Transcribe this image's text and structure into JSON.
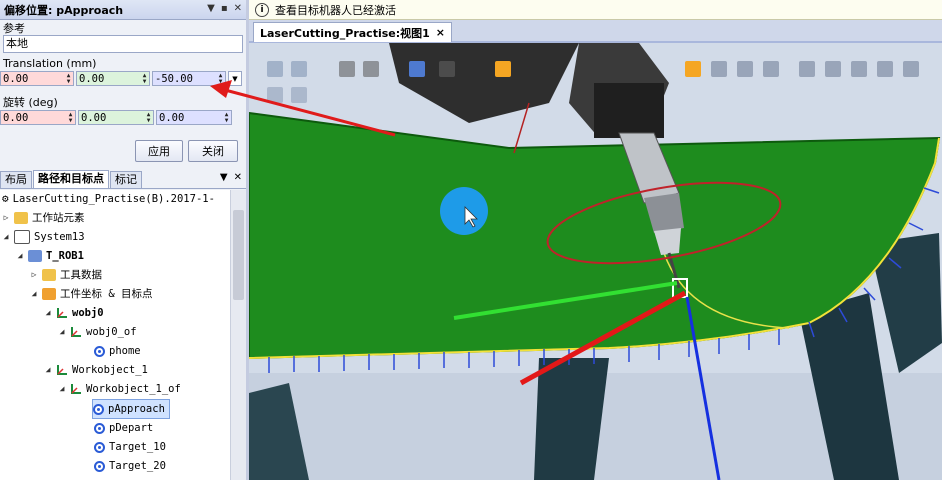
{
  "offset_panel": {
    "title": "偏移位置: pApproach",
    "reference_label": "参考",
    "reference_value": "本地",
    "translation_label": "Translation (mm)",
    "translation": [
      "0.00",
      "0.00",
      "-50.00"
    ],
    "rotation_label": "旋转 (deg)",
    "rotation": [
      "0.00",
      "0.00",
      "0.00"
    ],
    "apply_label": "应用",
    "close_label": "关闭"
  },
  "tabs": [
    "布局",
    "路径和目标点",
    "标记"
  ],
  "tree": {
    "station": "LaserCutting_Practise(B).2017-1-",
    "items": [
      {
        "label": "工作站元素"
      },
      {
        "label": "System13"
      },
      {
        "label": "T_ROB1"
      },
      {
        "label": "工具数据"
      },
      {
        "label": "工件坐标 & 目标点"
      },
      {
        "label": "wobj0"
      },
      {
        "label": "wobj0_of"
      },
      {
        "label": "phome"
      },
      {
        "label": "Workobject_1"
      },
      {
        "label": "Workobject_1_of"
      },
      {
        "label": "pApproach"
      },
      {
        "label": "pDepart"
      },
      {
        "label": "Target_10"
      },
      {
        "label": "Target_20"
      }
    ]
  },
  "info_bar": {
    "message": "查看目标机器人已经激活"
  },
  "view_tab": {
    "label": "LaserCutting_Practise:视图1",
    "close": "×"
  },
  "colors": {
    "panel_bg": "#eef1f7",
    "part_green": "#1f8a1f",
    "selection": "#cfe2ff"
  }
}
